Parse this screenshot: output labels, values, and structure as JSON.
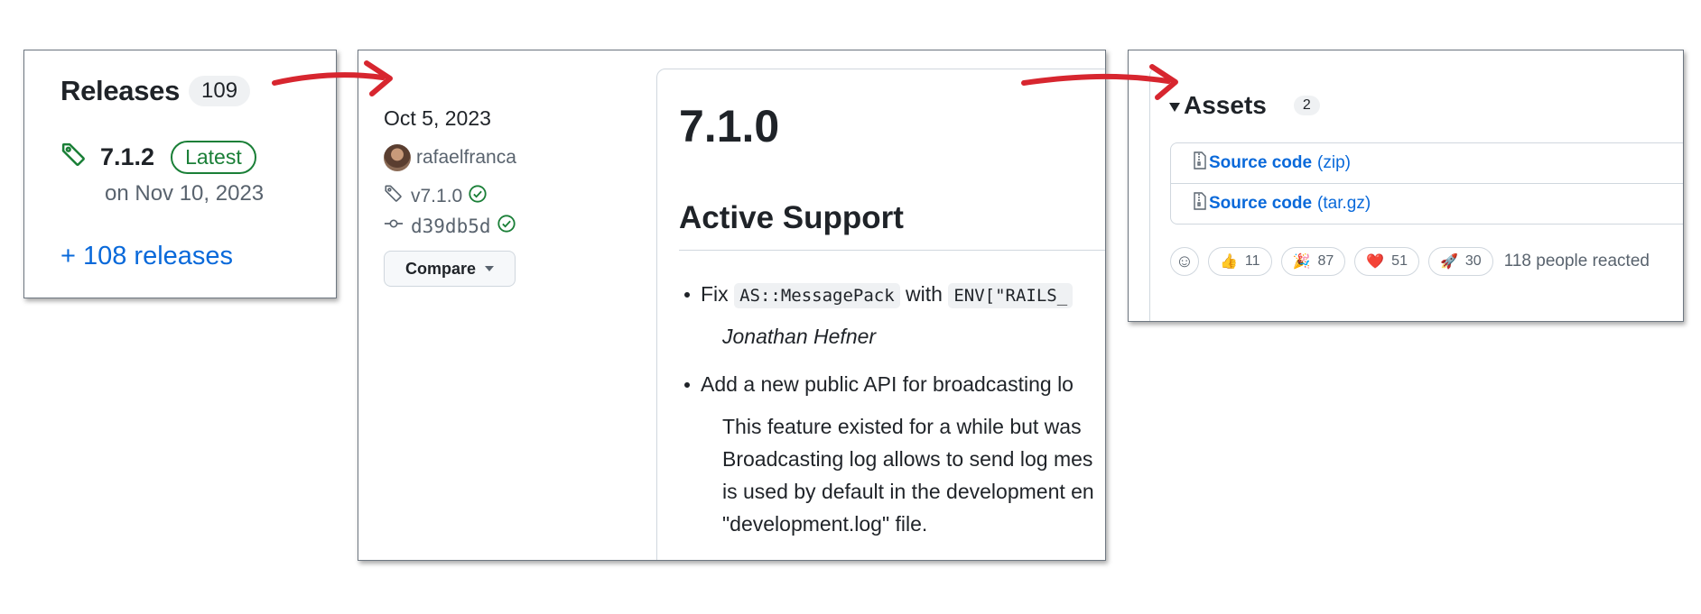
{
  "releases_panel": {
    "title": "Releases",
    "count": "109",
    "latest_version": "7.1.2",
    "latest_badge": "Latest",
    "latest_date": "on Nov 10, 2023",
    "more_link": "+ 108 releases"
  },
  "release_detail": {
    "date": "Oct 5, 2023",
    "author": "rafaelfranca",
    "tag": "v7.1.0",
    "commit": "d39db5d",
    "compare_label": "Compare",
    "version_heading": "7.1.0",
    "section_heading": "Active Support",
    "bullet1_prefix": "Fix",
    "bullet1_code1": "AS::MessagePack",
    "bullet1_mid": "with",
    "bullet1_code2": "ENV[\"RAILS_",
    "bullet1_author": "Jonathan Hefner",
    "bullet2_text": "Add a new public API for broadcasting lo",
    "para_line1": "This feature existed for a while but was",
    "para_line2": "Broadcasting log allows to send log mes",
    "para_line3": "is used by default in the development en",
    "para_line4": "\"development.log\" file."
  },
  "assets_panel": {
    "heading": "Assets",
    "count": "2",
    "assets": [
      {
        "name": "Source code",
        "ext": "(zip)"
      },
      {
        "name": "Source code",
        "ext": "(tar.gz)"
      }
    ],
    "reactions": [
      {
        "emoji": "👍",
        "count": "11"
      },
      {
        "emoji": "🎉",
        "count": "87"
      },
      {
        "emoji": "❤️",
        "count": "51"
      },
      {
        "emoji": "🚀",
        "count": "30"
      }
    ],
    "reacted_text": "118 people reacted"
  },
  "colors": {
    "link": "#0969da",
    "success": "#1a7f37",
    "arrow": "#d7262f"
  }
}
